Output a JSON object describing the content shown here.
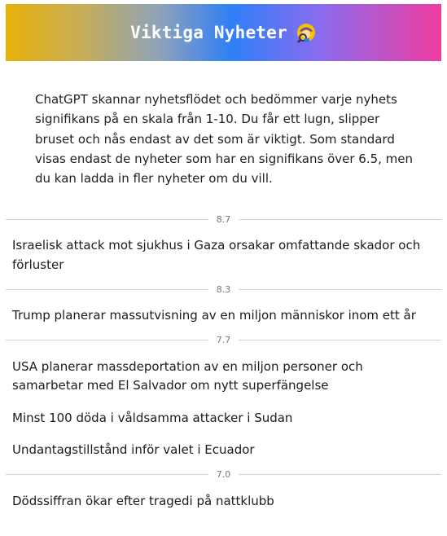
{
  "header": {
    "title": "Viktiga Nyheter",
    "icon": "detective-icon"
  },
  "intro": "ChatGPT skannar nyhetsflödet och bedömmer varje nyhets signifikans på en skala från 1-10. Du får ett lugn, slipper bruset och nås endast av det som är viktigt. Som standard visas endast de nyheter som har en signifikans över 6.5, men du kan ladda in fler nyheter om du vill.",
  "groups": [
    {
      "score": "8.7",
      "items": [
        "Israelisk attack mot sjukhus i Gaza orsakar omfattande skador och förluster"
      ]
    },
    {
      "score": "8.3",
      "items": [
        "Trump planerar massutvisning av en miljon människor inom ett år"
      ]
    },
    {
      "score": "7.7",
      "items": [
        "USA planerar massdeportation av en miljon personer och samarbetar med El Salvador om nytt superfängelse",
        "Minst 100 döda i våldsamma attacker i Sudan",
        "Undantagstillstånd inför valet i Ecuador"
      ]
    },
    {
      "score": "7.0",
      "items": [
        "Dödssiffran ökar efter tragedi på nattklubb"
      ]
    }
  ]
}
